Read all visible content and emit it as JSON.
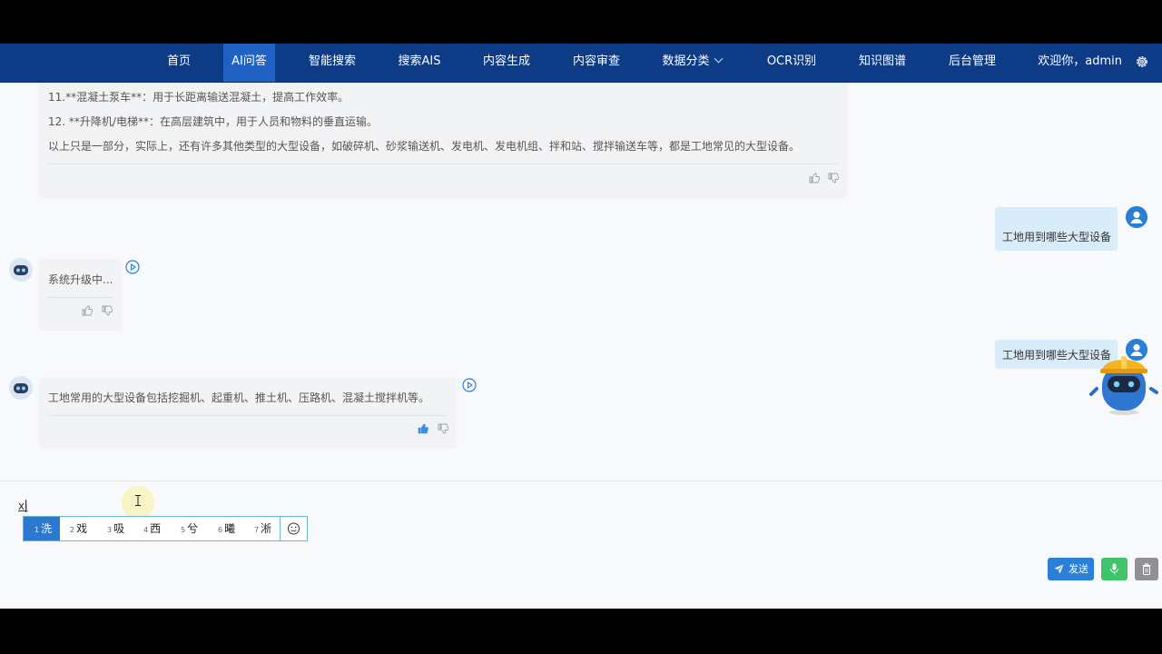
{
  "nav": {
    "items": [
      "首页",
      "AI问答",
      "智能搜索",
      "搜索AIS",
      "内容生成",
      "内容审查",
      "数据分类",
      "OCR识别",
      "知识图谱",
      "后台管理"
    ],
    "active": "AI问答",
    "welcome": "欢迎你，admin"
  },
  "chat": {
    "msg1_lines": [
      "11.**混凝土泵车**：用于长距离输送混凝土，提高工作效率。",
      "12. **升降机/电梯**：在高层建筑中，用于人员和物料的垂直运输。",
      "以上只是一部分，实际上，还有许多其他类型的大型设备，如破碎机、砂浆输送机、发电机、发电机组、拌和站、搅拌输送车等，都是工地常见的大型设备。"
    ],
    "user_q1": "工地用到哪些大型设备",
    "ai_msg2": "系统升级中...",
    "user_q2": "工地用到哪些大型设备",
    "ai_msg3": "工地常用的大型设备包括挖掘机、起重机、推土机、压路机、混凝土搅拌机等。"
  },
  "input": {
    "typed": "xi",
    "candidates": [
      {
        "num": "1",
        "char": "洗"
      },
      {
        "num": "2",
        "char": "戏"
      },
      {
        "num": "3",
        "char": "吸"
      },
      {
        "num": "4",
        "char": "西"
      },
      {
        "num": "5",
        "char": "兮"
      },
      {
        "num": "6",
        "char": "曦"
      },
      {
        "num": "7",
        "char": "淅"
      }
    ]
  },
  "buttons": {
    "send": "发送"
  },
  "colors": {
    "navbar": "#0d3b86",
    "nav_active": "#1f62c4",
    "send": "#2b7fd6",
    "mic": "#3fc46b",
    "delete": "#8f9196",
    "user_bubble": "#d8edf9"
  }
}
